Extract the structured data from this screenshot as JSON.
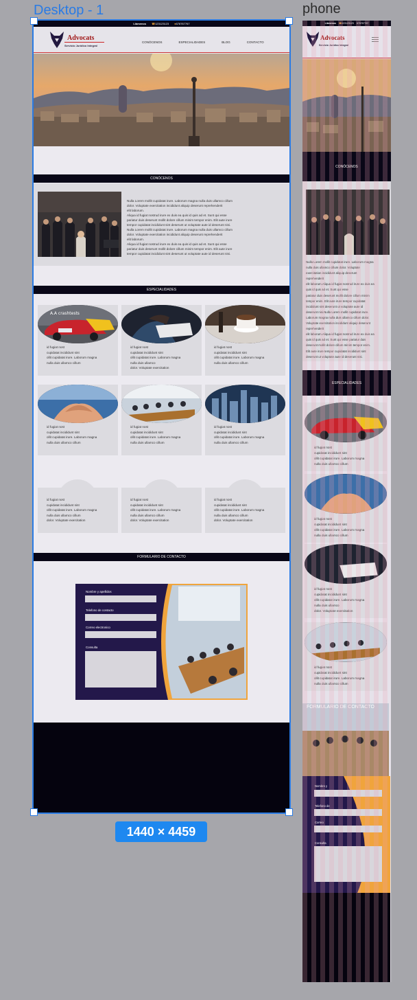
{
  "canvas": {
    "desktop_frame_label": "Desktop - 1",
    "phone_frame_label": "phone",
    "dimension_badge": "1440 × 4459",
    "more_menu": "..."
  },
  "topbar": {
    "call_label": "Llámenos",
    "phone1": "123123123",
    "phone2": "678767767"
  },
  "brand": {
    "name": "Advocats",
    "tagline": "Servicio Jurídico Integral"
  },
  "nav": [
    "CONÓCENOS",
    "ESPECIALIDADES",
    "BLOG",
    "CONTACTO"
  ],
  "sections": {
    "about_title": "CONÓCENOS",
    "specialties_title": "ESPECIALIDADES",
    "contact_title": "FORMULARIO DE CONTACTO"
  },
  "about": {
    "lines": [
      "Nulla Lorem mollit cupidatat irure. Laborum magna nulla duis ullamco cillum",
      "dolor. Voluptate exercitation incididunt aliquip deserunt reprehenderit",
      "elit laborum.",
      "Aliqua id fugiat nostrud irure ex duis ea quis id quis ad et. Sunt qui esse",
      " pariatur duis deserunt mollit dolore cillum minim tempor enim. Elit aute irure",
      "tempor cupidatat incididunt sint deserunt ut voluptate aute id deserunt nisi.",
      "Nulla Lorem mollit cupidatat irure. Laborum magna nulla duis ullamco cillum",
      "dolor. Voluptate exercitation incididunt aliquip deserunt reprehenderit",
      "elit laborum.",
      "Aliqua id fugiat nostrud irure ex duis ea quis id quis ad et. Sunt qui esse",
      " pariatur duis deserunt mollit dolore cillum minim tempor enim. Elit aute irure",
      "tempor cupidatat incididunt sint deserunt ut voluptate aute id deserunt nisi."
    ]
  },
  "cards": [
    {
      "lines": [
        "id fugiat nost",
        "cupidatat incididunt sint",
        "ollit cupidatat irure. Laborum magna",
        "nulla duis ullamco cillum"
      ]
    },
    {
      "lines": [
        "id fugiat nost",
        "cupidatat incididunt sint",
        "ollit cupidatat irure. Laborum magna",
        "nulla duis ullamco",
        "dolor. Voluptate exercitation"
      ]
    },
    {
      "lines": [
        "id fugiat nost",
        "cupidatat incididunt sint",
        "ollit cupidatat irure. Laborum magna",
        "nulla duis ullamco cillum"
      ]
    },
    {
      "lines": [
        "id fugiat nost",
        "cupidatat incididunt sint",
        "ollit cupidatat irure. Laborum magna",
        "nulla duis ullamco cillum"
      ]
    },
    {
      "lines": [
        "id fugiat nost",
        "cupidatat incididunt sint",
        "ollit cupidatat irure. Laborum magna",
        "nulla duis ullamco cillum"
      ]
    },
    {
      "lines": [
        "id fugiat nost",
        "cupidatat incididunt sint",
        "ollit cupidatat irure. Laborum magna",
        "nulla duis ullamco cillum"
      ]
    },
    {
      "lines": [
        "id fugiat nost",
        "cupidatat incididunt sint",
        "ollit cupidatat irure. Laborum magna",
        "nulla duis ullamco cillum",
        "dolor. Voluptate exercitation"
      ]
    },
    {
      "lines": [
        "id fugiat nost",
        "cupidatat incididunt sint",
        "ollit cupidatat irure. Laborum magna",
        "nulla duis ullamco cillum",
        "dolor. Voluptate exercitation"
      ]
    },
    {
      "lines": [
        "id fugiat nost",
        "cupidatat incididunt sint",
        "ollit cupidatat irure. Laborum magna",
        "nulla duis ullamco cillum",
        "dolor. Voluptate exercitation"
      ]
    }
  ],
  "form": {
    "name_label": "Nombre y apellidos",
    "phone_label": "Telefono de contacto",
    "email_label": "Correo electronico",
    "query_label": "Consulta"
  },
  "phone": {
    "about_lines": [
      "Nulla Lorem mollit cupidatat irure. Laborum magna",
      "nulla duis ullamco cillum dolor. Voluptate",
      "exercitation incididunt aliquip deserunt",
      "reprehenderit",
      "elit laborum.Aliqua id fugiat nostrud irure ex duis ea",
      "quis id quis ad et. Sunt qui esse",
      " pariatur duis deserunt mollit dolore cillum minim",
      "tempor enim. Elit aute irure tempor cupidatat",
      "incididunt sint deserunt ut voluptate aute id",
      "deserunt nisi.Nulla Lorem mollit cupidatat irure.",
      "Laborum magna nulla duis ullamco cillum dolor.",
      "Voluptate exercitation incididunt aliquip deserunt",
      "reprehenderit",
      "elit laborum.Aliqua id fugiat nostrud irure ex duis ea",
      "quis id quis ad et. Sunt qui esse  pariatur duis",
      "deserunt mollit dolore cillum minim tempor enim.",
      "Elit aute irure tempor cupidatat incididunt sint",
      "deserunt ut voluptate aute id deserunt nisi."
    ],
    "cards": [
      {
        "lines": [
          "id fugiat nost",
          "cupidatat incididunt sint",
          "ollit cupidatat irure. Laborum magna",
          "nulla duis ullamco cillum"
        ]
      },
      {
        "lines": [
          "id fugiat nost",
          "cupidatat incididunt sint",
          "ollit cupidatat irure. Laborum magna",
          "nulla duis ullamco cillum"
        ]
      },
      {
        "lines": [
          "id fugiat nost",
          "cupidatat incididunt sint",
          "ollit cupidatat irure. Laborum magna",
          "nulla duis ullamco",
          "dolor. Voluptate exercitation"
        ]
      },
      {
        "lines": [
          "id fugiat nost",
          "cupidatat incididunt sint",
          "ollit cupidatat irure. Laborum magna",
          "nulla duis ullamco cillum"
        ]
      }
    ],
    "form": {
      "name_label": "Nombre y",
      "phone_label": "Telefono de",
      "email_label": "Correo",
      "query_label": "Consulta"
    }
  }
}
